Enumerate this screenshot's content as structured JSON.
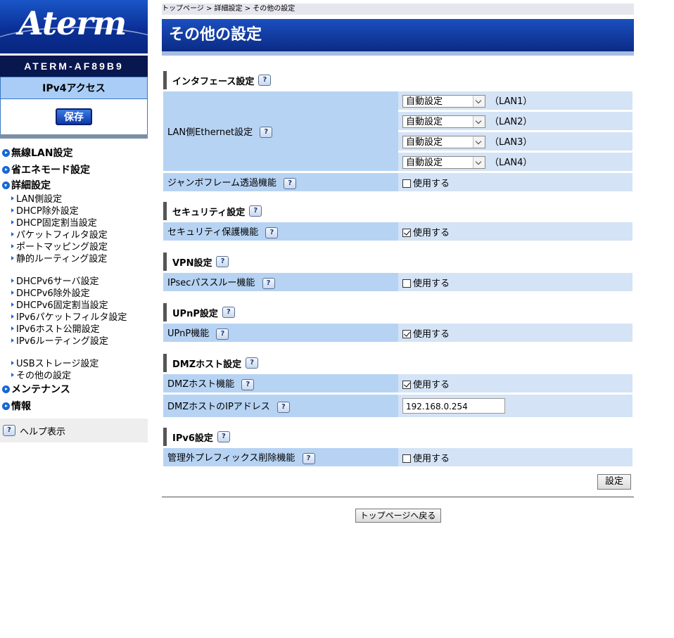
{
  "sidebar": {
    "brand": "Aterm",
    "device_name": "ATERM-AF89B9",
    "mode": "IPv4アクセス",
    "save_label": "保存",
    "nav": [
      {
        "type": "top",
        "label": "無線LAN設定",
        "state": "right"
      },
      {
        "type": "top",
        "label": "省エネモード設定",
        "state": "right"
      },
      {
        "type": "top",
        "label": "詳細設定",
        "state": "down"
      }
    ],
    "sub_group1": [
      "LAN側設定",
      "DHCP除外設定",
      "DHCP固定割当設定",
      "パケットフィルタ設定",
      "ポートマッピング設定",
      "静的ルーティング設定"
    ],
    "sub_group2": [
      "DHCPv6サーバ設定",
      "DHCPv6除外設定",
      "DHCPv6固定割当設定",
      "IPv6パケットフィルタ設定",
      "IPv6ホスト公開設定",
      "IPv6ルーティング設定"
    ],
    "sub_group3": [
      "USBストレージ設定",
      "その他の設定"
    ],
    "nav_bottom": [
      {
        "label": "メンテナンス"
      },
      {
        "label": "情報"
      }
    ],
    "help_label": "ヘルプ表示"
  },
  "main": {
    "breadcrumb": "トップページ > 詳細設定 > その他の設定",
    "title": "その他の設定",
    "help_glyph": "?",
    "interface": {
      "heading": "インタフェース設定",
      "lan_label": "LAN側Ethernet設定",
      "ports": [
        {
          "value": "自動設定",
          "name": "（LAN1）"
        },
        {
          "value": "自動設定",
          "name": "（LAN2）"
        },
        {
          "value": "自動設定",
          "name": "（LAN3）"
        },
        {
          "value": "自動設定",
          "name": "（LAN4）"
        }
      ],
      "jumbo_label": "ジャンボフレーム透過機能",
      "jumbo_checked": false
    },
    "security": {
      "heading": "セキュリティ設定",
      "label": "セキュリティ保護機能",
      "checked": true
    },
    "vpn": {
      "heading": "VPN設定",
      "label": "IPsecパススルー機能",
      "checked": false
    },
    "upnp": {
      "heading": "UPnP設定",
      "label": "UPnP機能",
      "checked": true
    },
    "dmz": {
      "heading": "DMZホスト設定",
      "label": "DMZホスト機能",
      "checked": true,
      "ip_label": "DMZホストのIPアドレス",
      "ip_value": "192.168.0.254"
    },
    "ipv6": {
      "heading": "IPv6設定",
      "label": "管理外プレフィックス削除機能",
      "checked": false
    },
    "use_label": "使用する",
    "set_button": "設定",
    "back_button": "トップページへ戻る"
  }
}
